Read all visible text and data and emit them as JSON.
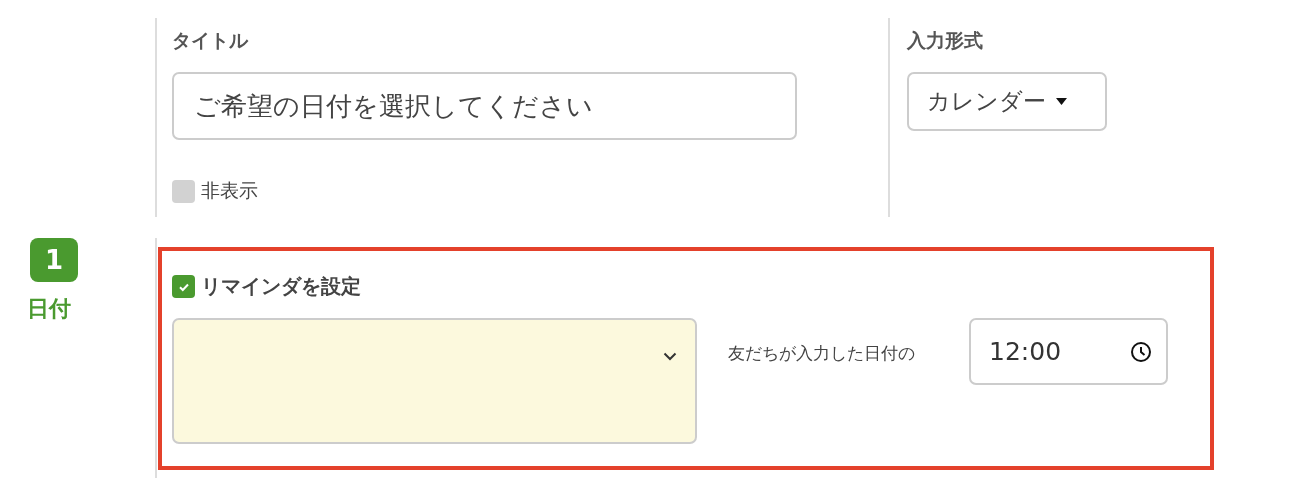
{
  "title_field": {
    "label": "タイトル",
    "value": "ご希望の日付を選択してください"
  },
  "hidden_option": {
    "label": "非表示",
    "checked": false
  },
  "input_format": {
    "label": "入力形式",
    "value": "カレンダー"
  },
  "step": {
    "number": "1",
    "label": "日付"
  },
  "reminder": {
    "label": "リマインダを設定",
    "checked": true,
    "caption": "友だちが入力した日付の",
    "time": "12:00"
  }
}
